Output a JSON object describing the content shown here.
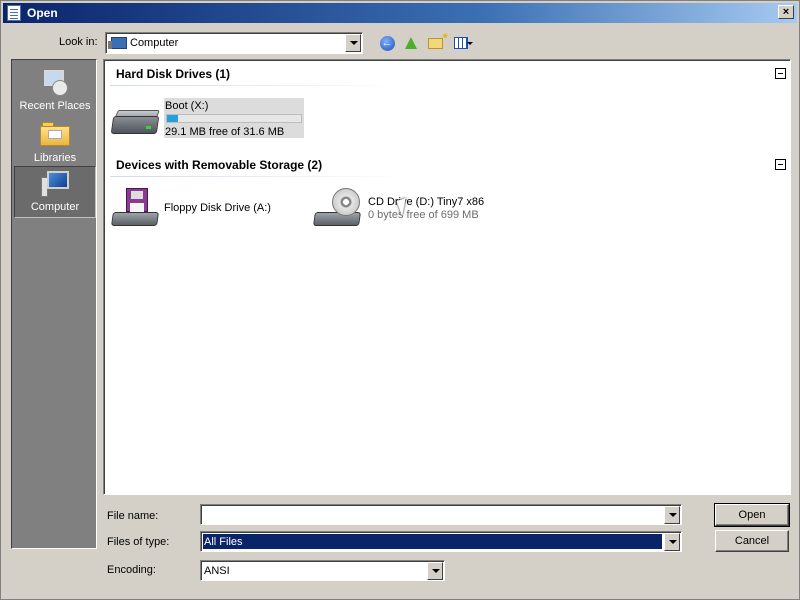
{
  "window": {
    "title": "Open",
    "close_glyph": "×"
  },
  "toolbar": {
    "look_in_label": "Look in:",
    "look_in_value": "Computer",
    "back_icon": "back-arrow-icon",
    "up_icon": "up-folder-icon",
    "new_folder_icon": "new-folder-icon",
    "views_icon": "views-menu-icon"
  },
  "places": [
    {
      "label": "Recent Places",
      "icon": "recent-places-icon"
    },
    {
      "label": "Libraries",
      "icon": "libraries-icon"
    },
    {
      "label": "Computer",
      "icon": "computer-icon",
      "selected": true
    }
  ],
  "groups": {
    "hdd": {
      "header": "Hard Disk Drives (1)",
      "items": [
        {
          "name": "Boot (X:)",
          "free": "29.1 MB free of 31.6 MB",
          "used_fraction": 0.08
        }
      ]
    },
    "removable": {
      "header": "Devices with Removable Storage (2)",
      "items": [
        {
          "name": "Floppy Disk Drive (A:)"
        },
        {
          "name": "CD Drive (D:) Tiny7 x86",
          "free": "0 bytes free of 699 MB"
        }
      ]
    }
  },
  "fields": {
    "file_name_label": "File name:",
    "file_name_value": "",
    "files_of_type_label": "Files of type:",
    "files_of_type_value": "All Files",
    "encoding_label": "Encoding:",
    "encoding_value": "ANSI"
  },
  "buttons": {
    "open": "Open",
    "cancel": "Cancel"
  },
  "colors": {
    "title_bar": "#0a246a",
    "selection": "#0a246a",
    "usage_bar": "#26a0da"
  }
}
